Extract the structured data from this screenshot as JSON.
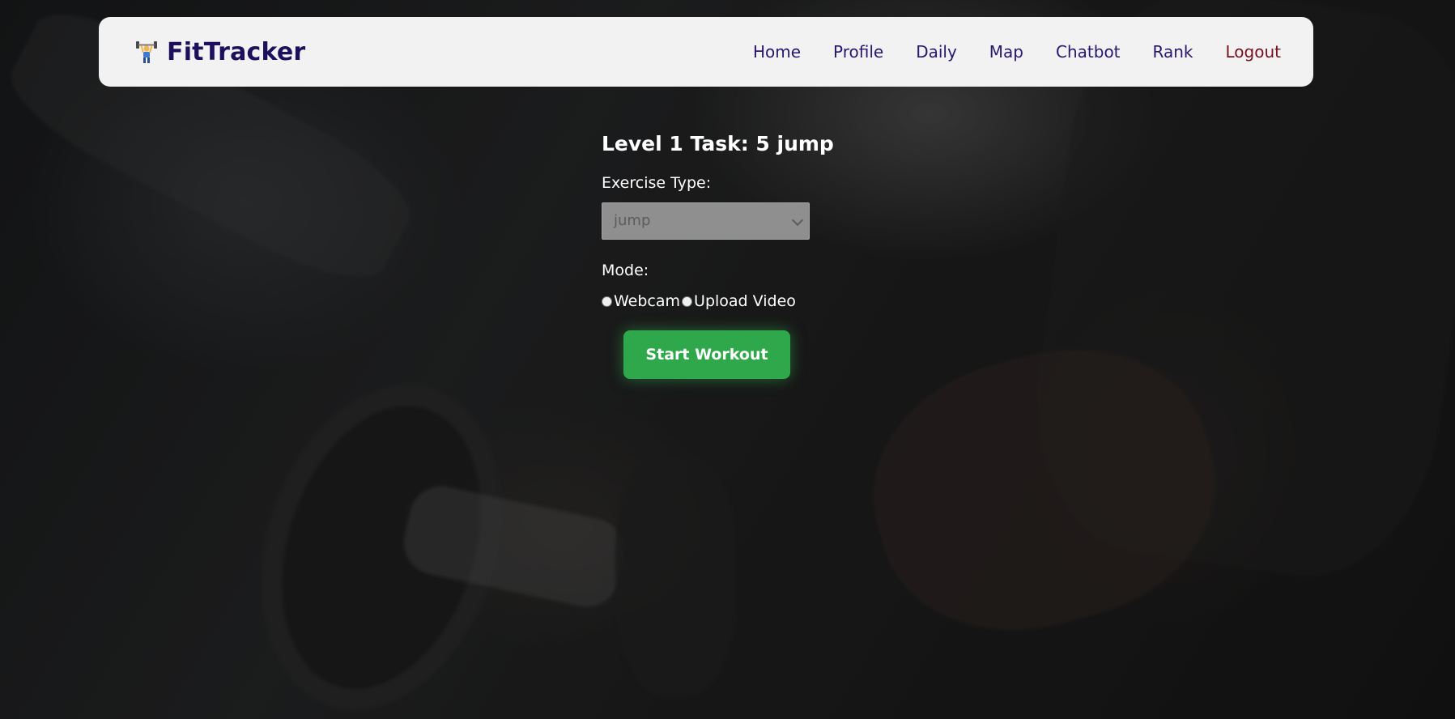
{
  "app": {
    "brand_name": "FitTracker",
    "brand_icon": "weightlifter-icon"
  },
  "nav": {
    "items": [
      {
        "label": "Home"
      },
      {
        "label": "Profile"
      },
      {
        "label": "Daily"
      },
      {
        "label": "Map"
      },
      {
        "label": "Chatbot"
      },
      {
        "label": "Rank"
      },
      {
        "label": "Logout"
      }
    ]
  },
  "task": {
    "title": "Level 1 Task: 5 jump"
  },
  "form": {
    "exercise_label": "Exercise Type:",
    "exercise_value": "jump",
    "mode_label": "Mode:",
    "mode_options": [
      {
        "label": "Webcam",
        "selected": false
      },
      {
        "label": "Upload Video",
        "selected": false
      }
    ],
    "start_button": "Start Workout"
  },
  "colors": {
    "brand": "#1e0f5c",
    "nav_text": "#2a1670",
    "logout": "#7a0f1e",
    "start_button": "#2ea84a"
  }
}
